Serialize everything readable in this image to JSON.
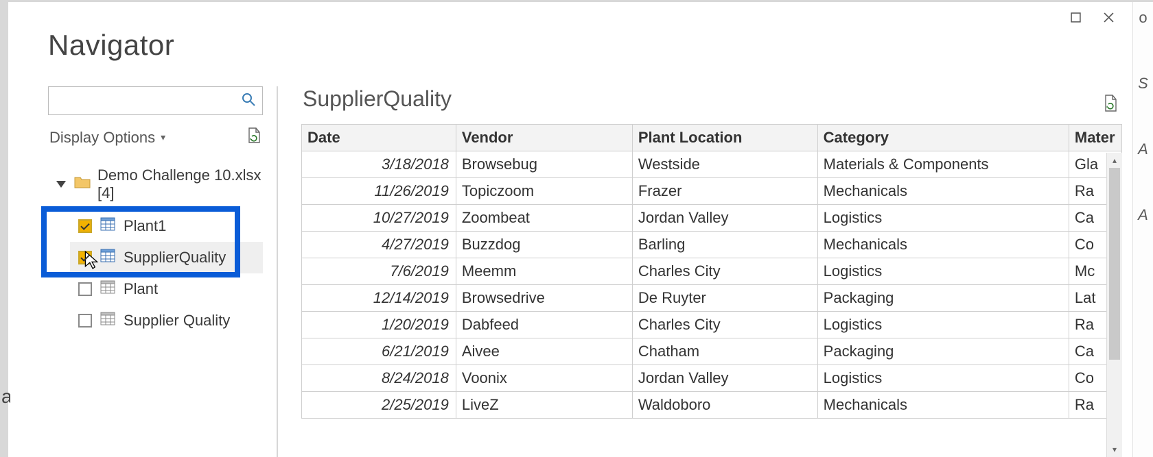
{
  "window": {
    "title": "Navigator"
  },
  "left": {
    "search_placeholder": "",
    "display_options_label": "Display Options",
    "root_label": "Demo Challenge 10.xlsx [4]",
    "items": [
      {
        "label": "Plant1",
        "checked": true,
        "selected": false,
        "query": false
      },
      {
        "label": "SupplierQuality",
        "checked": true,
        "selected": true,
        "query": false
      },
      {
        "label": "Plant",
        "checked": false,
        "selected": false,
        "query": true
      },
      {
        "label": "Supplier Quality",
        "checked": false,
        "selected": false,
        "query": true
      }
    ]
  },
  "preview": {
    "title": "SupplierQuality",
    "columns": [
      "Date",
      "Vendor",
      "Plant Location",
      "Category",
      "Mater"
    ],
    "rows": [
      {
        "date": "3/18/2018",
        "vendor": "Browsebug",
        "plant": "Westside",
        "category": "Materials & Components",
        "mat": "Gla"
      },
      {
        "date": "11/26/2019",
        "vendor": "Topiczoom",
        "plant": "Frazer",
        "category": "Mechanicals",
        "mat": "Ra"
      },
      {
        "date": "10/27/2019",
        "vendor": "Zoombeat",
        "plant": "Jordan Valley",
        "category": "Logistics",
        "mat": "Ca"
      },
      {
        "date": "4/27/2019",
        "vendor": "Buzzdog",
        "plant": "Barling",
        "category": "Mechanicals",
        "mat": "Co"
      },
      {
        "date": "7/6/2019",
        "vendor": "Meemm",
        "plant": "Charles City",
        "category": "Logistics",
        "mat": "Mc"
      },
      {
        "date": "12/14/2019",
        "vendor": "Browsedrive",
        "plant": "De Ruyter",
        "category": "Packaging",
        "mat": "Lat"
      },
      {
        "date": "1/20/2019",
        "vendor": "Dabfeed",
        "plant": "Charles City",
        "category": "Logistics",
        "mat": "Ra"
      },
      {
        "date": "6/21/2019",
        "vendor": "Aivee",
        "plant": "Chatham",
        "category": "Packaging",
        "mat": "Ca"
      },
      {
        "date": "8/24/2018",
        "vendor": "Voonix",
        "plant": "Jordan Valley",
        "category": "Logistics",
        "mat": "Co"
      },
      {
        "date": "2/25/2019",
        "vendor": "LiveZ",
        "plant": "Waldoboro",
        "category": "Mechanicals",
        "mat": "Ra"
      }
    ]
  },
  "gutter": {
    "a": "o",
    "b": "S",
    "c": "A",
    "d": "A"
  },
  "crop_left": "a"
}
